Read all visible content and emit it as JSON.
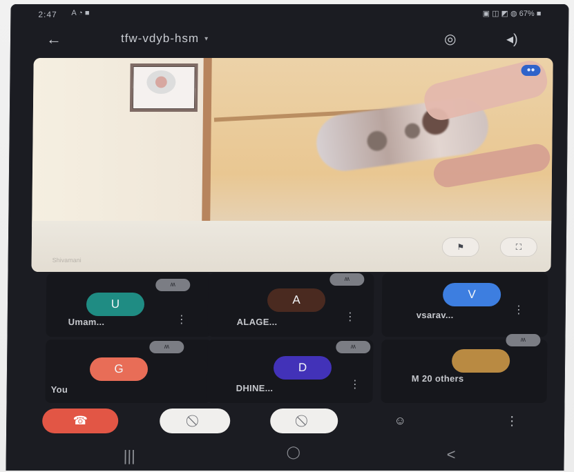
{
  "status_bar": {
    "time": "2:47",
    "icons": "A ◔ ■",
    "right": "▣ ◫ ◩ ◍ 67% ■"
  },
  "topbar": {
    "back_icon": "←",
    "meeting_code": "tfw-vdyb-hsm",
    "switch_camera_icon": "◎",
    "speaker_icon": "◂)"
  },
  "video": {
    "caption": "Shivamani",
    "pin_icon": "⚑",
    "fullscreen_icon": "⛶",
    "top_indicator_icon": "●●"
  },
  "participants": [
    {
      "name": "Umam...",
      "initial": "U",
      "color": "#1f8c83",
      "mute_icon": "ʍ"
    },
    {
      "name": "ALAGE...",
      "initial": "A",
      "color": "#4a2a20",
      "mute_icon": "ʍ"
    },
    {
      "name": "vsarav...",
      "initial": "V",
      "color": "#3d7ee0",
      "mute_icon": "ʍ"
    },
    {
      "name": "You",
      "initial": "G",
      "color": "#e86d57",
      "mute_icon": "ʍ"
    },
    {
      "name": "DHINE...",
      "initial": "D",
      "color": "#4232b8",
      "mute_icon": "ʍ"
    },
    {
      "name": "M",
      "extra": "20 others",
      "initial": "",
      "color": "#b98a42",
      "mute_icon": "ʍ"
    }
  ],
  "controls": {
    "end_call_icon": "☎",
    "video_off_icon": "⃠",
    "mic_off_icon": "⃠",
    "raise_hand_icon": "☺",
    "overflow_icon": "⋮"
  },
  "nav": {
    "recent_apps_icon": "|||",
    "home_icon": "◯",
    "back_icon": "<"
  }
}
